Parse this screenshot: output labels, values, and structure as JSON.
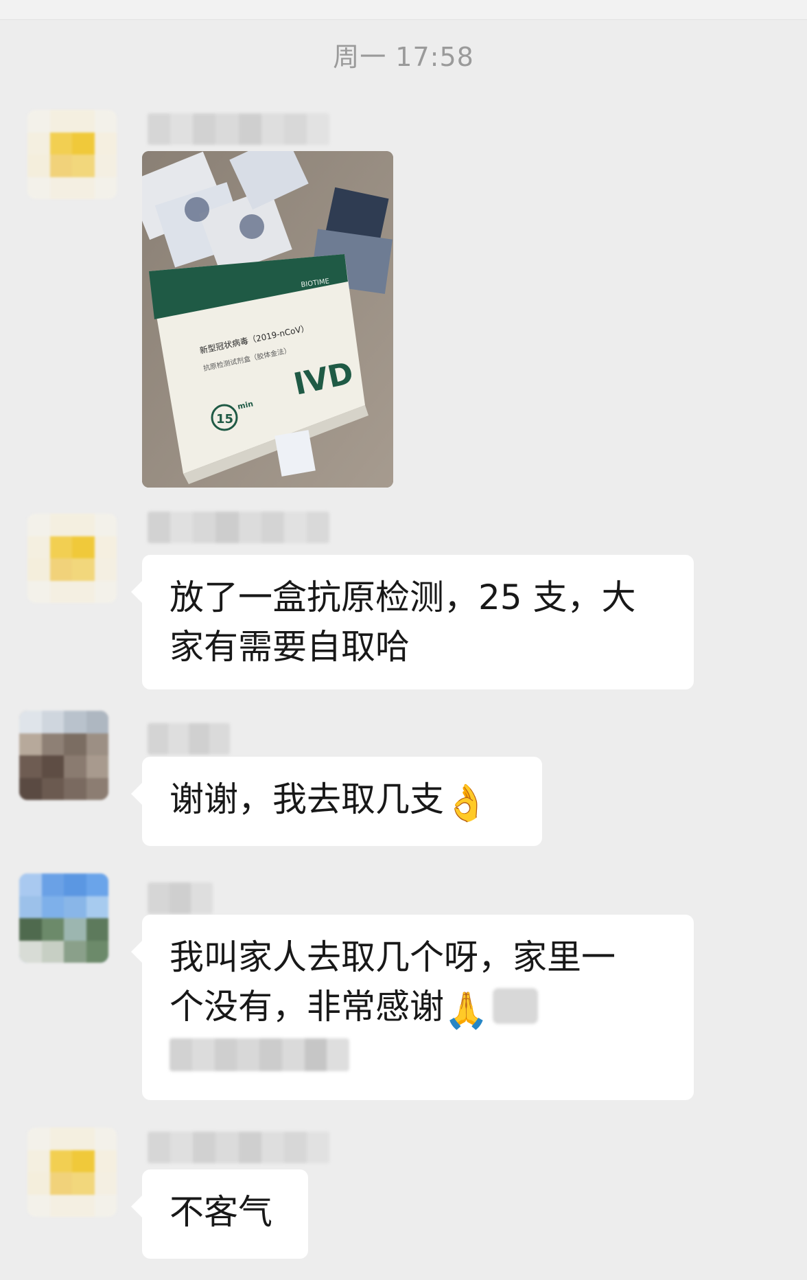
{
  "chat": {
    "timestamp": "周一 17:58",
    "messages": [
      {
        "type": "image",
        "image_caption": {
          "brand": "BIOTIME",
          "product": "新型冠状病毒（2019-nCoV）",
          "sub": "抗原检测试剂盒（胶体金法）",
          "badge": "IVD",
          "timer_value": "15",
          "timer_unit": "min"
        }
      },
      {
        "type": "text",
        "text_line1": "放了一盒抗原检测，25 支，大",
        "text_line2": "家有需要自取哈"
      },
      {
        "type": "text",
        "text": "谢谢，我去取几支",
        "emoji": "👌"
      },
      {
        "type": "text",
        "text_line1": "我叫家人去取几个呀，家里一",
        "text_line2": "个没有，非常感谢",
        "emoji": "🙏"
      },
      {
        "type": "text",
        "text": "不客气"
      }
    ]
  },
  "colors": {
    "background": "#ededed",
    "bubble": "#ffffff",
    "timestamp": "#9a9a9a",
    "text": "#181818",
    "box_green": "#1f5a45"
  }
}
